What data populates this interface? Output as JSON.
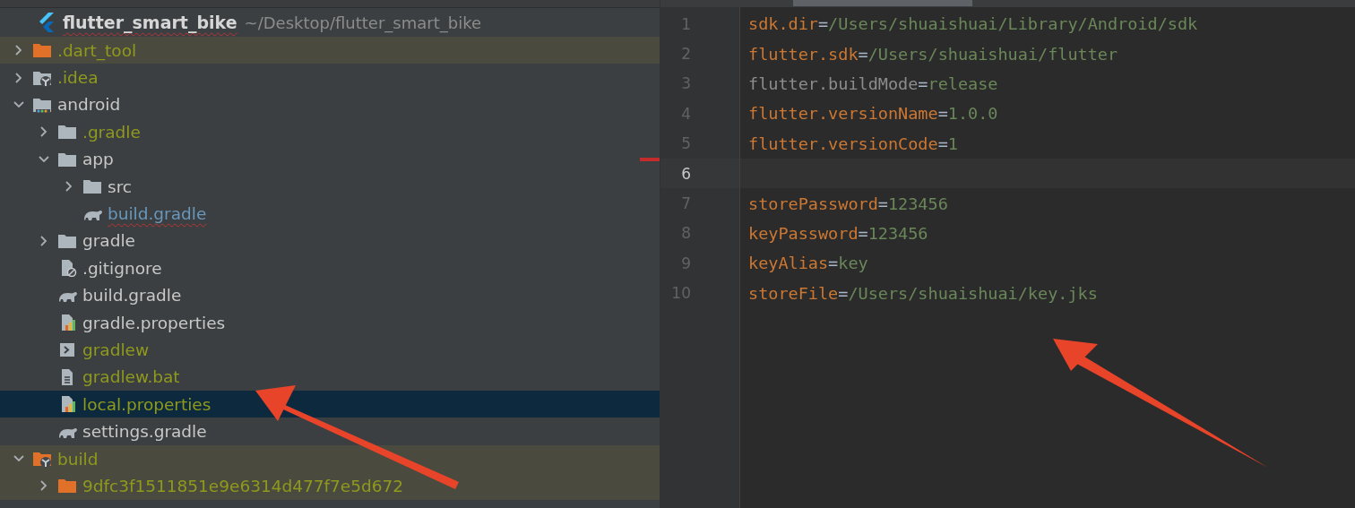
{
  "project": {
    "name": "flutter_smart_bike",
    "path": "~/Desktop/flutter_smart_bike"
  },
  "tree": [
    {
      "label": ".dart_tool",
      "kind": "folder-orange",
      "ignored": true,
      "modified": false,
      "excluded": true,
      "selected": false,
      "expanded": false
    },
    {
      "label": ".idea",
      "kind": "folder-idea",
      "ignored": true,
      "modified": false,
      "excluded": false,
      "selected": false,
      "expanded": false
    },
    {
      "label": "android",
      "kind": "folder-module",
      "ignored": false,
      "modified": false,
      "excluded": false,
      "selected": false,
      "expanded": true,
      "children": [
        {
          "label": ".gradle",
          "kind": "folder",
          "ignored": true,
          "modified": false,
          "excluded": false,
          "selected": false,
          "expanded": false
        },
        {
          "label": "app",
          "kind": "folder",
          "ignored": false,
          "modified": false,
          "excluded": false,
          "selected": false,
          "expanded": true,
          "children": [
            {
              "label": "src",
              "kind": "folder",
              "ignored": false,
              "modified": false,
              "excluded": false,
              "selected": false,
              "expanded": false
            },
            {
              "label": "build.gradle",
              "kind": "gradle",
              "modified": true,
              "excluded": false,
              "selected": false
            }
          ]
        },
        {
          "label": "gradle",
          "kind": "folder",
          "ignored": false,
          "modified": false,
          "excluded": false,
          "selected": false,
          "expanded": false
        },
        {
          "label": ".gitignore",
          "kind": "ignore-file",
          "ignored": false,
          "modified": false,
          "excluded": false,
          "selected": false
        },
        {
          "label": "build.gradle",
          "kind": "gradle",
          "ignored": false,
          "modified": false,
          "excluded": false,
          "selected": false
        },
        {
          "label": "gradle.properties",
          "kind": "properties",
          "ignored": false,
          "modified": false,
          "excluded": false,
          "selected": false
        },
        {
          "label": "gradlew",
          "kind": "shell",
          "ignored": true,
          "modified": false,
          "excluded": false,
          "selected": false
        },
        {
          "label": "gradlew.bat",
          "kind": "text-file",
          "ignored": true,
          "modified": false,
          "excluded": false,
          "selected": false
        },
        {
          "label": "local.properties",
          "kind": "properties",
          "ignored": true,
          "modified": false,
          "excluded": false,
          "selected": true
        },
        {
          "label": "settings.gradle",
          "kind": "gradle",
          "ignored": false,
          "modified": false,
          "excluded": false,
          "selected": false
        }
      ]
    },
    {
      "label": "build",
      "kind": "folder-build",
      "ignored": true,
      "modified": false,
      "excluded": true,
      "selected": false,
      "expanded": true,
      "children": [
        {
          "label": "9dfc3f1511851e9e6314d477f7e5d672",
          "kind": "folder-orange",
          "ignored": true,
          "modified": false,
          "excluded": true,
          "selected": false,
          "expanded": false
        }
      ]
    }
  ],
  "editor": {
    "lines": [
      {
        "number": "1",
        "kind": "property",
        "key": "sdk.dir",
        "sep": "=",
        "value": "/Users/shuaishuai/Library/Android/sdk",
        "current": false
      },
      {
        "number": "2",
        "kind": "property",
        "key": "flutter.sdk",
        "sep": "=",
        "value": "/Users/shuaishuai/flutter",
        "current": false
      },
      {
        "number": "3",
        "kind": "inactive",
        "key": "flutter.buildMode",
        "sep": "=",
        "value": "release",
        "current": false
      },
      {
        "number": "4",
        "kind": "property",
        "key": "flutter.versionName",
        "sep": "=",
        "value": "1.0.0",
        "current": false
      },
      {
        "number": "5",
        "kind": "property",
        "key": "flutter.versionCode",
        "sep": "=",
        "value": "1",
        "current": false
      },
      {
        "number": "6",
        "kind": "empty",
        "current": true
      },
      {
        "number": "7",
        "kind": "property",
        "key": "storePassword",
        "sep": "=",
        "value": "123456",
        "current": false
      },
      {
        "number": "8",
        "kind": "property",
        "key": "keyPassword",
        "sep": "=",
        "value": "123456",
        "current": false
      },
      {
        "number": "9",
        "kind": "property",
        "key": "keyAlias",
        "sep": "=",
        "value": "key",
        "current": false
      },
      {
        "number": "10",
        "kind": "property",
        "key": "storeFile",
        "sep": "=",
        "value": "/Users/shuaishuai/key.jks",
        "current": false
      }
    ]
  }
}
